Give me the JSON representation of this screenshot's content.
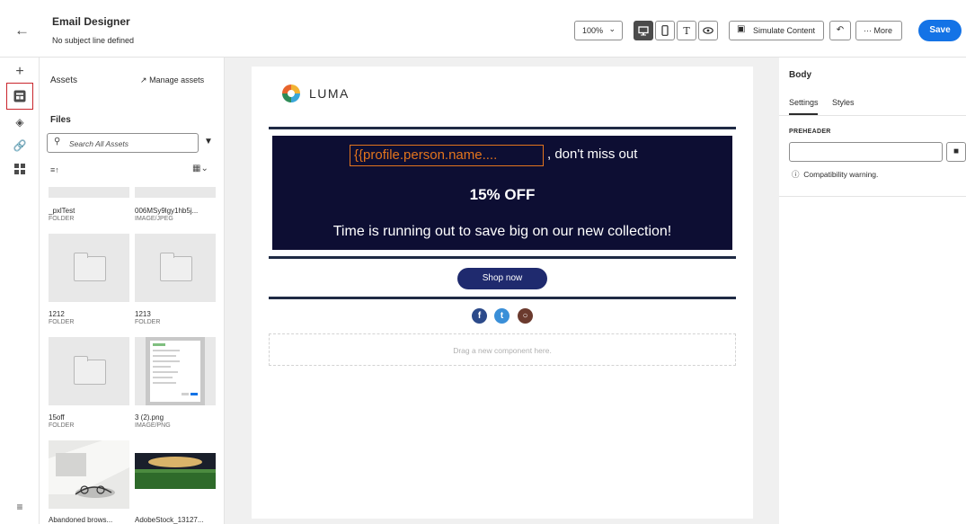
{
  "header": {
    "title": "Email Designer",
    "subtitle": "No subject line defined",
    "zoom": "100%",
    "simulate_label": "Simulate Content",
    "more_label": "More",
    "save_label": "Save"
  },
  "assets": {
    "title": "Assets",
    "manage_label": "Manage assets",
    "files_title": "Files",
    "search_placeholder": "Search All Assets",
    "items": [
      {
        "name": "_pxlTest",
        "type": "FOLDER"
      },
      {
        "name": "006MSy9lgy1hb5j...",
        "type": "IMAGE/JPEG"
      },
      {
        "name": "1212",
        "type": "FOLDER"
      },
      {
        "name": "1213",
        "type": "FOLDER"
      },
      {
        "name": "15off",
        "type": "FOLDER"
      },
      {
        "name": "3 (2).png",
        "type": "IMAGE/PNG"
      },
      {
        "name": "Abandoned brows...",
        "type": ""
      },
      {
        "name": "AdobeStock_13127...",
        "type": ""
      }
    ]
  },
  "email": {
    "logo_text": "LUMA",
    "personalization": "{{profile.person.name....",
    "headline": ", don't miss out",
    "offer": "15% OFF",
    "tagline": "Time is running out to save big on our new collection!",
    "cta": "Shop now",
    "dropzone": "Drag a new component here."
  },
  "props": {
    "title": "Body",
    "tabs": [
      "Settings",
      "Styles"
    ],
    "preheader_label": "PREHEADER",
    "warning": "Compatibility warning."
  },
  "colors": {
    "accent": "#1473e6",
    "hero_bg": "#0d0e33",
    "personalization": "#e2741d",
    "cta_bg": "#1f2a6e",
    "highlight": "#c9252c"
  }
}
